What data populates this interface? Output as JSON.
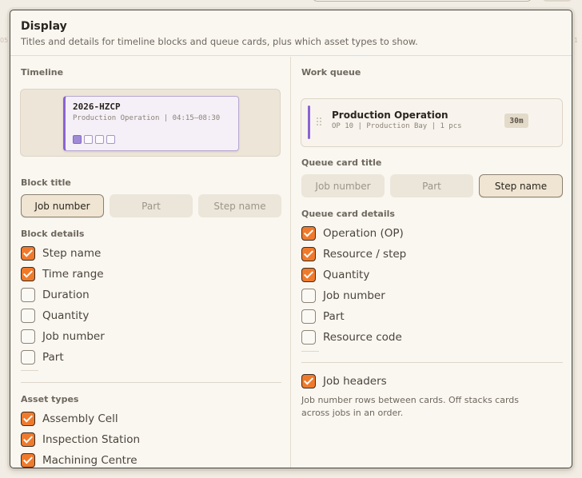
{
  "background": {
    "left_tick": "05",
    "right_tick": "1"
  },
  "popover": {
    "title": "Display",
    "subtitle": "Titles and details for timeline blocks and queue cards, plus which asset types to show."
  },
  "timeline": {
    "label": "Timeline",
    "preview": {
      "title": "2026-HZCP",
      "subtitle": "Production Operation | 04:15–08:30",
      "dots": [
        true,
        false,
        false,
        false
      ]
    },
    "block_title_label": "Block title",
    "block_title_options": [
      "Job number",
      "Part",
      "Step name"
    ],
    "block_title_selected": 0,
    "block_details_label": "Block details",
    "block_details": [
      {
        "label": "Step name",
        "checked": true
      },
      {
        "label": "Time range",
        "checked": true
      },
      {
        "label": "Duration",
        "checked": false
      },
      {
        "label": "Quantity",
        "checked": false
      },
      {
        "label": "Job number",
        "checked": false
      },
      {
        "label": "Part",
        "checked": false
      }
    ]
  },
  "asset_types": {
    "label": "Asset types",
    "items": [
      {
        "label": "Assembly Cell",
        "checked": true
      },
      {
        "label": "Inspection Station",
        "checked": true
      },
      {
        "label": "Machining Centre",
        "checked": true
      }
    ]
  },
  "work_queue": {
    "label": "Work queue",
    "preview": {
      "title": "Production Operation",
      "subtitle": "OP 10 | Production Bay | 1 pcs",
      "badge": "30m"
    },
    "card_title_label": "Queue card title",
    "card_title_options": [
      "Job number",
      "Part",
      "Step name"
    ],
    "card_title_selected": 2,
    "card_details_label": "Queue card details",
    "card_details": [
      {
        "label": "Operation (OP)",
        "checked": true
      },
      {
        "label": "Resource / step",
        "checked": true
      },
      {
        "label": "Quantity",
        "checked": true
      },
      {
        "label": "Job number",
        "checked": false
      },
      {
        "label": "Part",
        "checked": false
      },
      {
        "label": "Resource code",
        "checked": false
      }
    ],
    "job_headers": {
      "label": "Job headers",
      "checked": true
    },
    "job_headers_help": "Job number rows between cards. Off stacks cards across jobs in an order."
  },
  "colors": {
    "accent_orange": "#f07a2c",
    "accent_purple": "#8a63d2",
    "panel_bg": "#faf7f1"
  }
}
